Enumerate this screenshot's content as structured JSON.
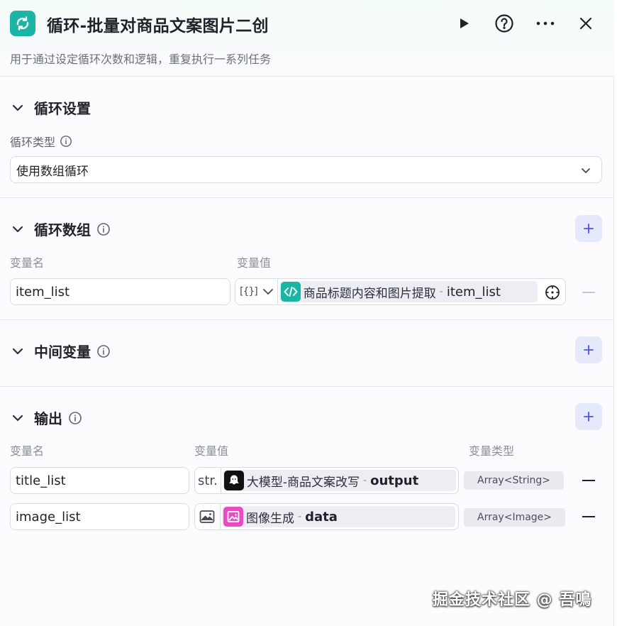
{
  "header": {
    "title": "循环-批量对商品文案图片二创",
    "description": "用于通过设定循环次数和逻辑，重复执行一系列任务",
    "icon": "loop-icon",
    "accent_color": "#1bb5a6"
  },
  "loop_settings": {
    "section_title": "循环设置",
    "type_label": "循环类型",
    "type_value": "使用数组循环"
  },
  "loop_array": {
    "section_title": "循环数组",
    "col_name": "变量名",
    "col_value": "变量值",
    "rows": [
      {
        "name": "item_list",
        "type_symbol": "[{}]",
        "node": "商品标题内容和图片提取",
        "sep": "-",
        "var": "item_list"
      }
    ]
  },
  "middle_vars": {
    "section_title": "中间变量"
  },
  "output": {
    "section_title": "输出",
    "col_name": "变量名",
    "col_value": "变量值",
    "col_type": "变量类型",
    "rows": [
      {
        "name": "title_list",
        "type_symbol": "str.",
        "node": "大模型-商品文案改写",
        "sep": "-",
        "var": "output",
        "var_type": "Array<String>"
      },
      {
        "name": "image_list",
        "type_symbol": "image-icon",
        "node": "图像生成",
        "sep": "-",
        "var": "data",
        "var_type": "Array<Image>"
      }
    ]
  },
  "watermark": "掘金技术社区 @ 吾鳴"
}
